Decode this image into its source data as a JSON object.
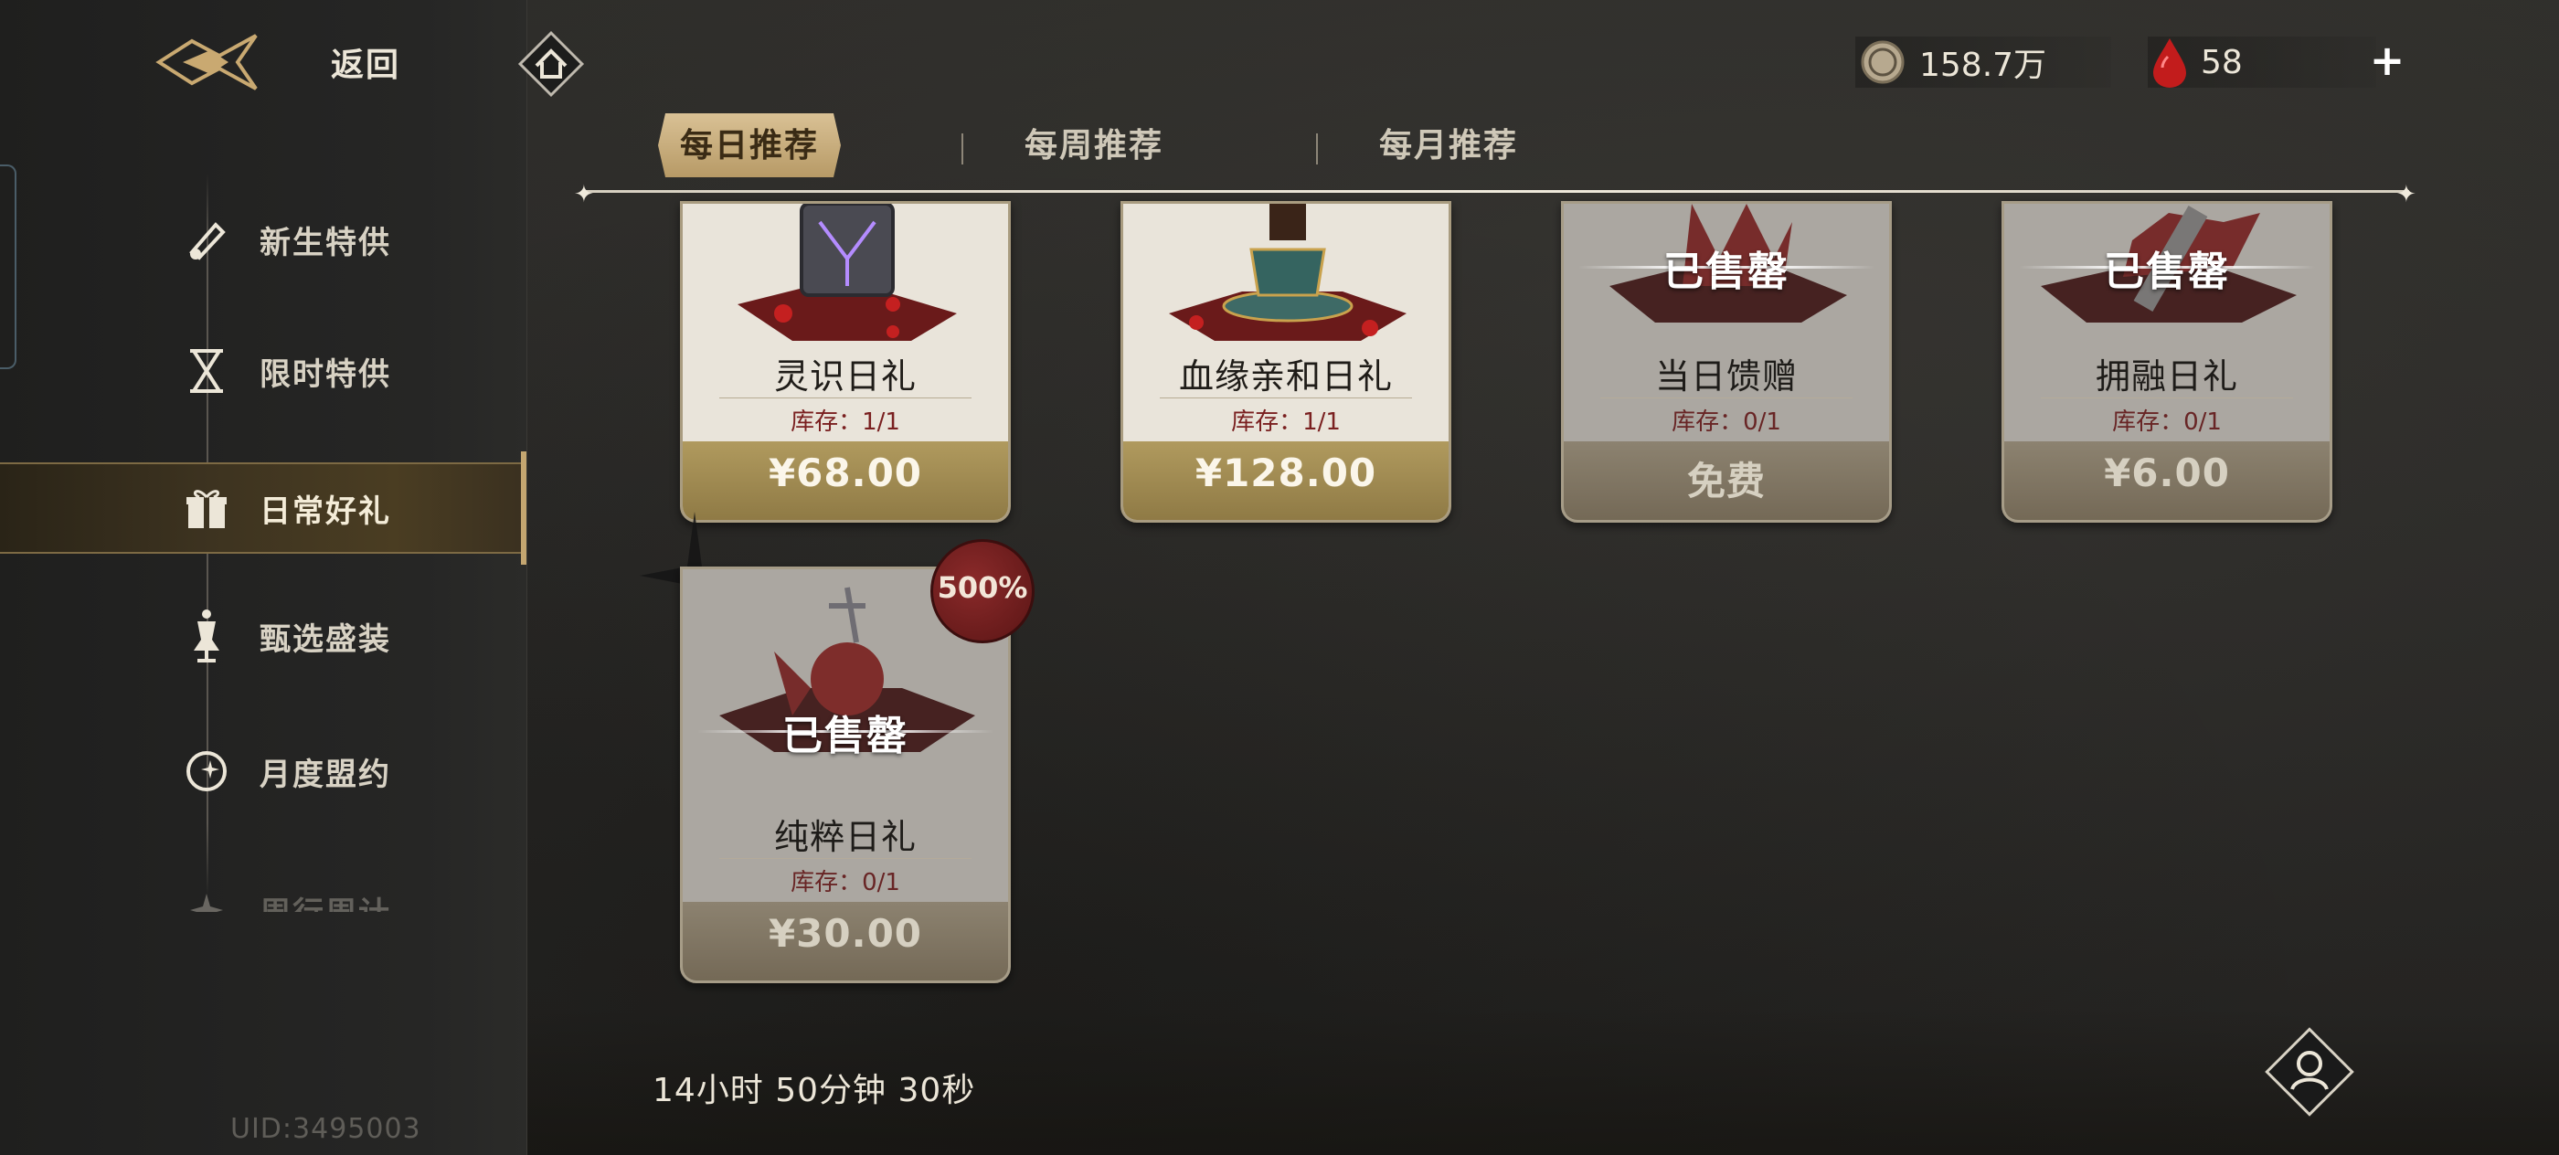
{
  "header": {
    "back_label": "返回",
    "coin_amount": "158.7万",
    "blood_amount": "58",
    "plus_label": "+"
  },
  "sidebar": {
    "items": [
      {
        "label": "新生特供",
        "icon": "scroll-icon"
      },
      {
        "label": "限时特供",
        "icon": "hourglass-icon"
      },
      {
        "label": "日常好礼",
        "icon": "gift-icon",
        "active": true
      },
      {
        "label": "甄选盛装",
        "icon": "mannequin-icon"
      },
      {
        "label": "月度盟约",
        "icon": "moon-icon"
      },
      {
        "label": "周行周计",
        "icon": "star-icon"
      }
    ],
    "uid": "UID:3495003"
  },
  "tabs": [
    {
      "label": "每日推荐",
      "active": true
    },
    {
      "label": "每周推荐",
      "active": false
    },
    {
      "label": "每月推荐",
      "active": false
    }
  ],
  "products": [
    {
      "name": "灵识日礼",
      "stock": "库存：1/1",
      "price": "¥68.00",
      "sold_out": false,
      "sold_label": ""
    },
    {
      "name": "血缘亲和日礼",
      "stock": "库存：1/1",
      "price": "¥128.00",
      "sold_out": false,
      "sold_label": ""
    },
    {
      "name": "当日馈赠",
      "stock": "库存：0/1",
      "price": "免费",
      "sold_out": true,
      "sold_label": "已售罄"
    },
    {
      "name": "拥融日礼",
      "stock": "库存：0/1",
      "price": "¥6.00",
      "sold_out": true,
      "sold_label": "已售罄"
    },
    {
      "name": "纯粹日礼",
      "stock": "库存：0/1",
      "price": "¥30.00",
      "sold_out": true,
      "sold_label": "已售罄",
      "badge": "500%"
    }
  ],
  "timer": "14小时  50分钟  30秒",
  "colors": {
    "accent_gold": "#c4a670",
    "price_bar": "#a38d55",
    "stock_red": "#7a2020",
    "card_bg": "#e9e4da"
  }
}
